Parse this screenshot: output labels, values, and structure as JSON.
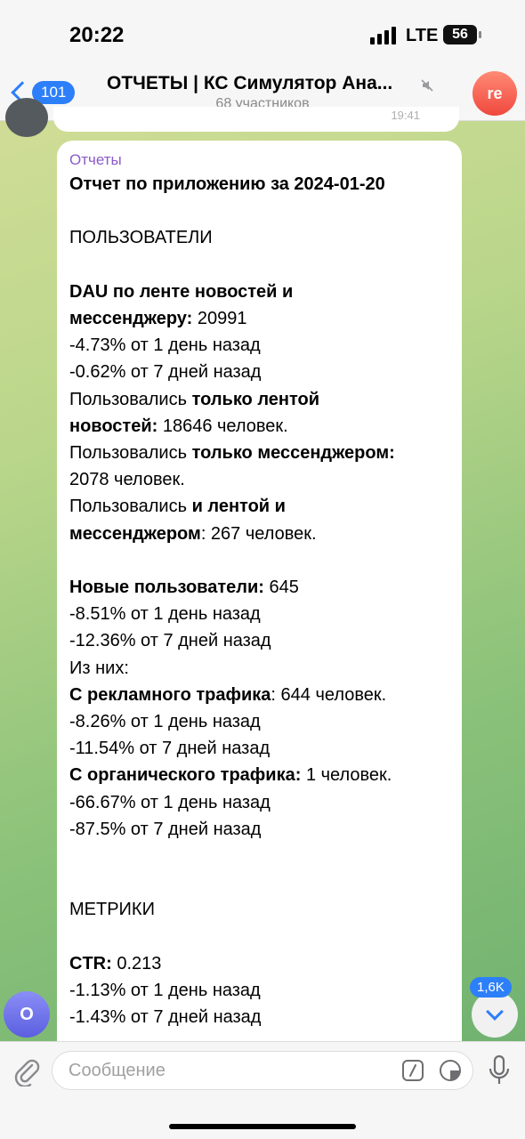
{
  "status": {
    "time": "20:22",
    "network": "LTE",
    "battery": "56"
  },
  "header": {
    "back_count": "101",
    "title": "ОТЧЕТЫ | КС Симулятор Ана...",
    "subtitle": "68 участников",
    "avatar_initials": "re"
  },
  "prev_message": {
    "time": "19:41"
  },
  "message": {
    "sender": "Отчеты",
    "title": "Отчет по приложению за 2024-01-20",
    "users_heading": "ПОЛЬЗОВАТЕЛИ",
    "dau_label_1": "DAU по ленте новостей и",
    "dau_label_2": "мессенджеру:",
    "dau_value": " 20991",
    "dau_d1": "-4.73% от 1 день назад",
    "dau_d7": "-0.62% от 7 дней назад",
    "used_prefix": "Пользовались ",
    "feed_only_label_1": "только лентой",
    "feed_only_label_2": "новостей:",
    "feed_only_value": " 18646 человек.",
    "msg_only_label": "только мессенджером:",
    "msg_only_value": "2078 человек.",
    "both_label_1": "и лентой и",
    "both_label_2": "мессенджером",
    "both_value": ": 267 человек.",
    "new_label": "Новые пользователи:",
    "new_value": " 645",
    "new_d1": "-8.51% от 1 день назад",
    "new_d7": "-12.36% от 7 дней назад",
    "of_them": "Из них:",
    "ads_label": "С рекламного трафика",
    "ads_value": ": 644 человек.",
    "ads_d1": "-8.26% от 1 день назад",
    "ads_d7": "-11.54% от 7 дней назад",
    "org_label": "С органического трафика:",
    "org_value": " 1 человек.",
    "org_d1": "-66.67% от 1 день назад",
    "org_d7": "-87.5% от 7 дней назад",
    "metrics_heading": "МЕТРИКИ",
    "ctr_label": "CTR:",
    "ctr_value": " 0.213",
    "ctr_d1": "-1.13% от 1 день назад",
    "ctr_d7": "-1.43% от 7 дней назад"
  },
  "floating": {
    "left_avatar": "O",
    "unread_badge": "1,6K"
  },
  "input": {
    "placeholder": "Сообщение"
  },
  "colors": {
    "accent": "#2d7ff9",
    "sender": "#8a5cc8"
  }
}
